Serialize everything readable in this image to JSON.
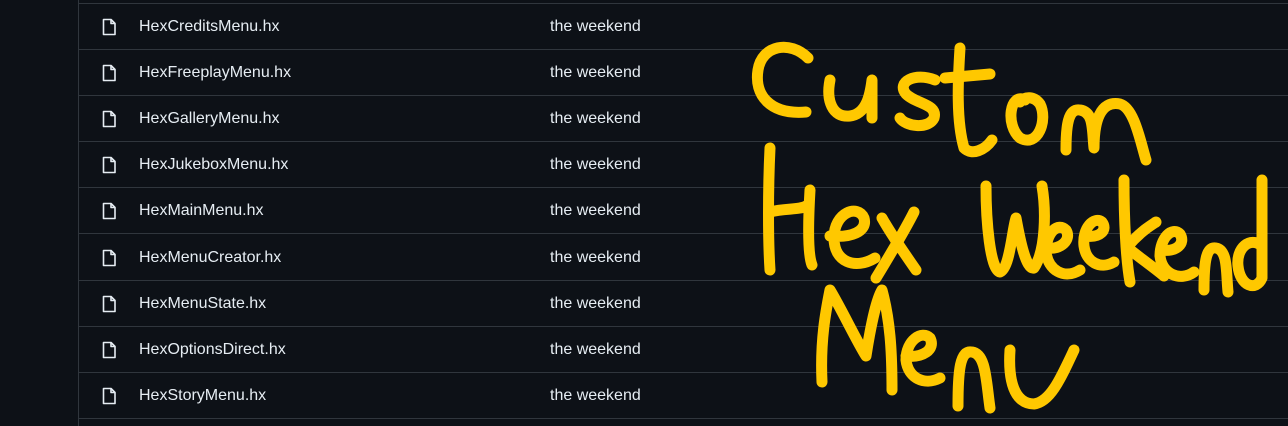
{
  "files": [
    {
      "name": "HexCreditsMenu.hx",
      "commit": "the weekend"
    },
    {
      "name": "HexFreeplayMenu.hx",
      "commit": "the weekend"
    },
    {
      "name": "HexGalleryMenu.hx",
      "commit": "the weekend"
    },
    {
      "name": "HexJukeboxMenu.hx",
      "commit": "the weekend"
    },
    {
      "name": "HexMainMenu.hx",
      "commit": "the weekend"
    },
    {
      "name": "HexMenuCreator.hx",
      "commit": "the weekend"
    },
    {
      "name": "HexMenuState.hx",
      "commit": "the weekend"
    },
    {
      "name": "HexOptionsDirect.hx",
      "commit": "the weekend"
    },
    {
      "name": "HexStoryMenu.hx",
      "commit": "the weekend"
    }
  ],
  "icons": {
    "file": "file-icon"
  },
  "annotation": {
    "text": "Custom Hex Weekend Menu",
    "color": "#ffc800"
  },
  "colors": {
    "background": "#0d1117",
    "border": "#30363d",
    "text": "#e6edf3"
  }
}
